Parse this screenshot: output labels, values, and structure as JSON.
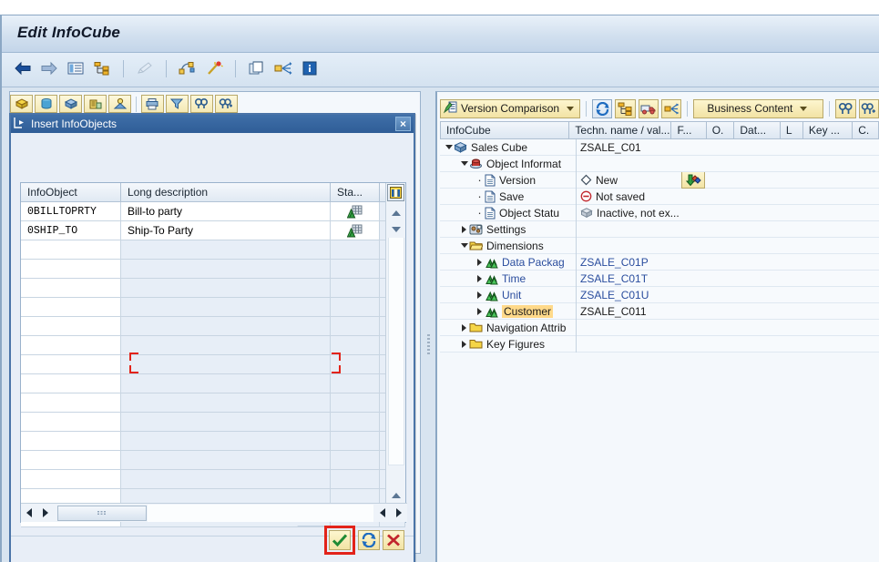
{
  "window": {
    "title": "Edit InfoCube"
  },
  "main_toolbar": {
    "items": [
      {
        "name": "back-icon",
        "label": "Back"
      },
      {
        "name": "forward-icon",
        "label": "Forward"
      },
      {
        "name": "list-icon",
        "label": "List"
      },
      {
        "name": "hierarchy-icon",
        "label": "Hierarchy"
      },
      {
        "name": "pencil-icon",
        "label": "Edit"
      },
      {
        "name": "objects-icon",
        "label": "Objects"
      },
      {
        "name": "wand-icon",
        "label": "Wizard"
      },
      {
        "name": "copy-icon",
        "label": "Copy"
      },
      {
        "name": "network-icon",
        "label": "Network Display"
      },
      {
        "name": "info-icon",
        "label": "Information"
      }
    ]
  },
  "left_toolbar": {
    "items": [
      {
        "name": "yellow-cube-icon",
        "label": "InfoArea"
      },
      {
        "name": "cylinder-icon",
        "label": "InfoSource"
      },
      {
        "name": "blue-cube-icon",
        "label": "InfoCube"
      },
      {
        "name": "buildings-icon",
        "label": "InfoObject Catalog"
      },
      {
        "name": "person-icon",
        "label": "Characteristic"
      },
      {
        "name": "print-icon",
        "label": "Print"
      },
      {
        "name": "filter-icon",
        "label": "Filter"
      },
      {
        "name": "find-icon",
        "label": "Find"
      },
      {
        "name": "find-next-icon",
        "label": "Find Next"
      }
    ]
  },
  "dialog": {
    "title": "Insert InfoObjects",
    "close_label": "×",
    "grid": {
      "columns": [
        "InfoObject",
        "Long description",
        "Sta..."
      ],
      "rows": [
        {
          "infoobject": "0BILLTOPRTY",
          "description": "Bill-to party",
          "status_icon": "characteristic-icon"
        },
        {
          "infoobject": "0SHIP_TO",
          "description": "Ship-To Party",
          "status_icon": "characteristic-icon"
        }
      ],
      "empty_row_count": 15,
      "column_select_icon": "column-config-icon"
    },
    "footer_buttons": [
      {
        "name": "confirm-button",
        "label": "Continue",
        "icon": "green-check-icon",
        "highlighted": true
      },
      {
        "name": "refresh-button",
        "label": "Refresh",
        "icon": "refresh-icon",
        "highlighted": false
      },
      {
        "name": "cancel-button",
        "label": "Cancel",
        "icon": "red-x-icon",
        "highlighted": false
      }
    ],
    "annotation": {
      "type": "red-bracket",
      "target_row_index": 8
    }
  },
  "right_panel": {
    "toolbar": {
      "version_comparison": {
        "label": "Version Comparison",
        "icon": "version-comparison-icon"
      },
      "business_content": {
        "label": "Business Content",
        "icon": "business-content-icon"
      },
      "buttons": [
        {
          "name": "refresh-icon",
          "label": "Refresh"
        },
        {
          "name": "hierarchy-icon",
          "label": "Hierarchy Display"
        },
        {
          "name": "transport-icon",
          "label": "Transport"
        },
        {
          "name": "where-used-icon",
          "label": "Where-Used List"
        },
        {
          "name": "find-icon",
          "label": "Find"
        },
        {
          "name": "find-next-icon",
          "label": "Find Next"
        }
      ]
    },
    "columns": [
      "InfoCube",
      "Techn. name / val...",
      "F...",
      "O.",
      "Dat...",
      "L",
      "Key ...",
      "C."
    ],
    "tree": [
      {
        "indent": 0,
        "toggle": "down",
        "icon": "cube-icon",
        "label": "Sales Cube",
        "value": "ZSALE_C01",
        "value_color": "dark",
        "highlight": false
      },
      {
        "indent": 1,
        "toggle": "down",
        "icon": "object-info-icon",
        "label": "Object Informat",
        "value": "",
        "value_color": "dark",
        "highlight": false
      },
      {
        "indent": 2,
        "toggle": "dot",
        "icon": "document-icon",
        "label": "Version",
        "value": "New",
        "value_icon": "diamond-icon",
        "value_color": "dark",
        "highlight": false,
        "has_button": true,
        "button_icon": "version-compare-icon"
      },
      {
        "indent": 2,
        "toggle": "dot",
        "icon": "document-icon",
        "label": "Save",
        "value": "Not saved",
        "value_icon": "minus-circle-icon",
        "value_color": "dark",
        "highlight": false
      },
      {
        "indent": 2,
        "toggle": "dot",
        "icon": "document-icon",
        "label": "Object Statu",
        "value": "Inactive, not ex...",
        "value_icon": "grey-cube-icon",
        "value_color": "dark",
        "highlight": false
      },
      {
        "indent": 1,
        "toggle": "right",
        "icon": "settings-icon",
        "label": "Settings",
        "value": "",
        "value_color": "dark",
        "highlight": false
      },
      {
        "indent": 1,
        "toggle": "down",
        "icon": "folder-open-icon",
        "label": "Dimensions",
        "value": "",
        "value_color": "dark",
        "highlight": false
      },
      {
        "indent": 2,
        "toggle": "right",
        "icon": "dimension-icon",
        "label": "Data Packag",
        "value": "ZSALE_C01P",
        "value_color": "blue",
        "label_blue": true,
        "highlight": false
      },
      {
        "indent": 2,
        "toggle": "right",
        "icon": "dimension-icon",
        "label": "Time",
        "value": "ZSALE_C01T",
        "value_color": "blue",
        "label_blue": true,
        "highlight": false
      },
      {
        "indent": 2,
        "toggle": "right",
        "icon": "dimension-icon",
        "label": "Unit",
        "value": "ZSALE_C01U",
        "value_color": "blue",
        "label_blue": true,
        "highlight": false
      },
      {
        "indent": 2,
        "toggle": "right",
        "icon": "dimension-icon",
        "label": "Customer",
        "value": "ZSALE_C011",
        "value_color": "dark",
        "highlight": true
      },
      {
        "indent": 1,
        "toggle": "right",
        "icon": "folder-icon",
        "label": "Navigation Attrib",
        "value": "",
        "value_color": "dark",
        "highlight": false
      },
      {
        "indent": 1,
        "toggle": "right",
        "icon": "folder-icon",
        "label": "Key Figures",
        "value": "",
        "value_color": "dark",
        "highlight": false
      }
    ]
  },
  "colors": {
    "accent_blue": "#2f5d97",
    "highlight_orange": "#ffd98a",
    "annotation_red": "#e2231a",
    "link_blue": "#2a4d9e"
  }
}
